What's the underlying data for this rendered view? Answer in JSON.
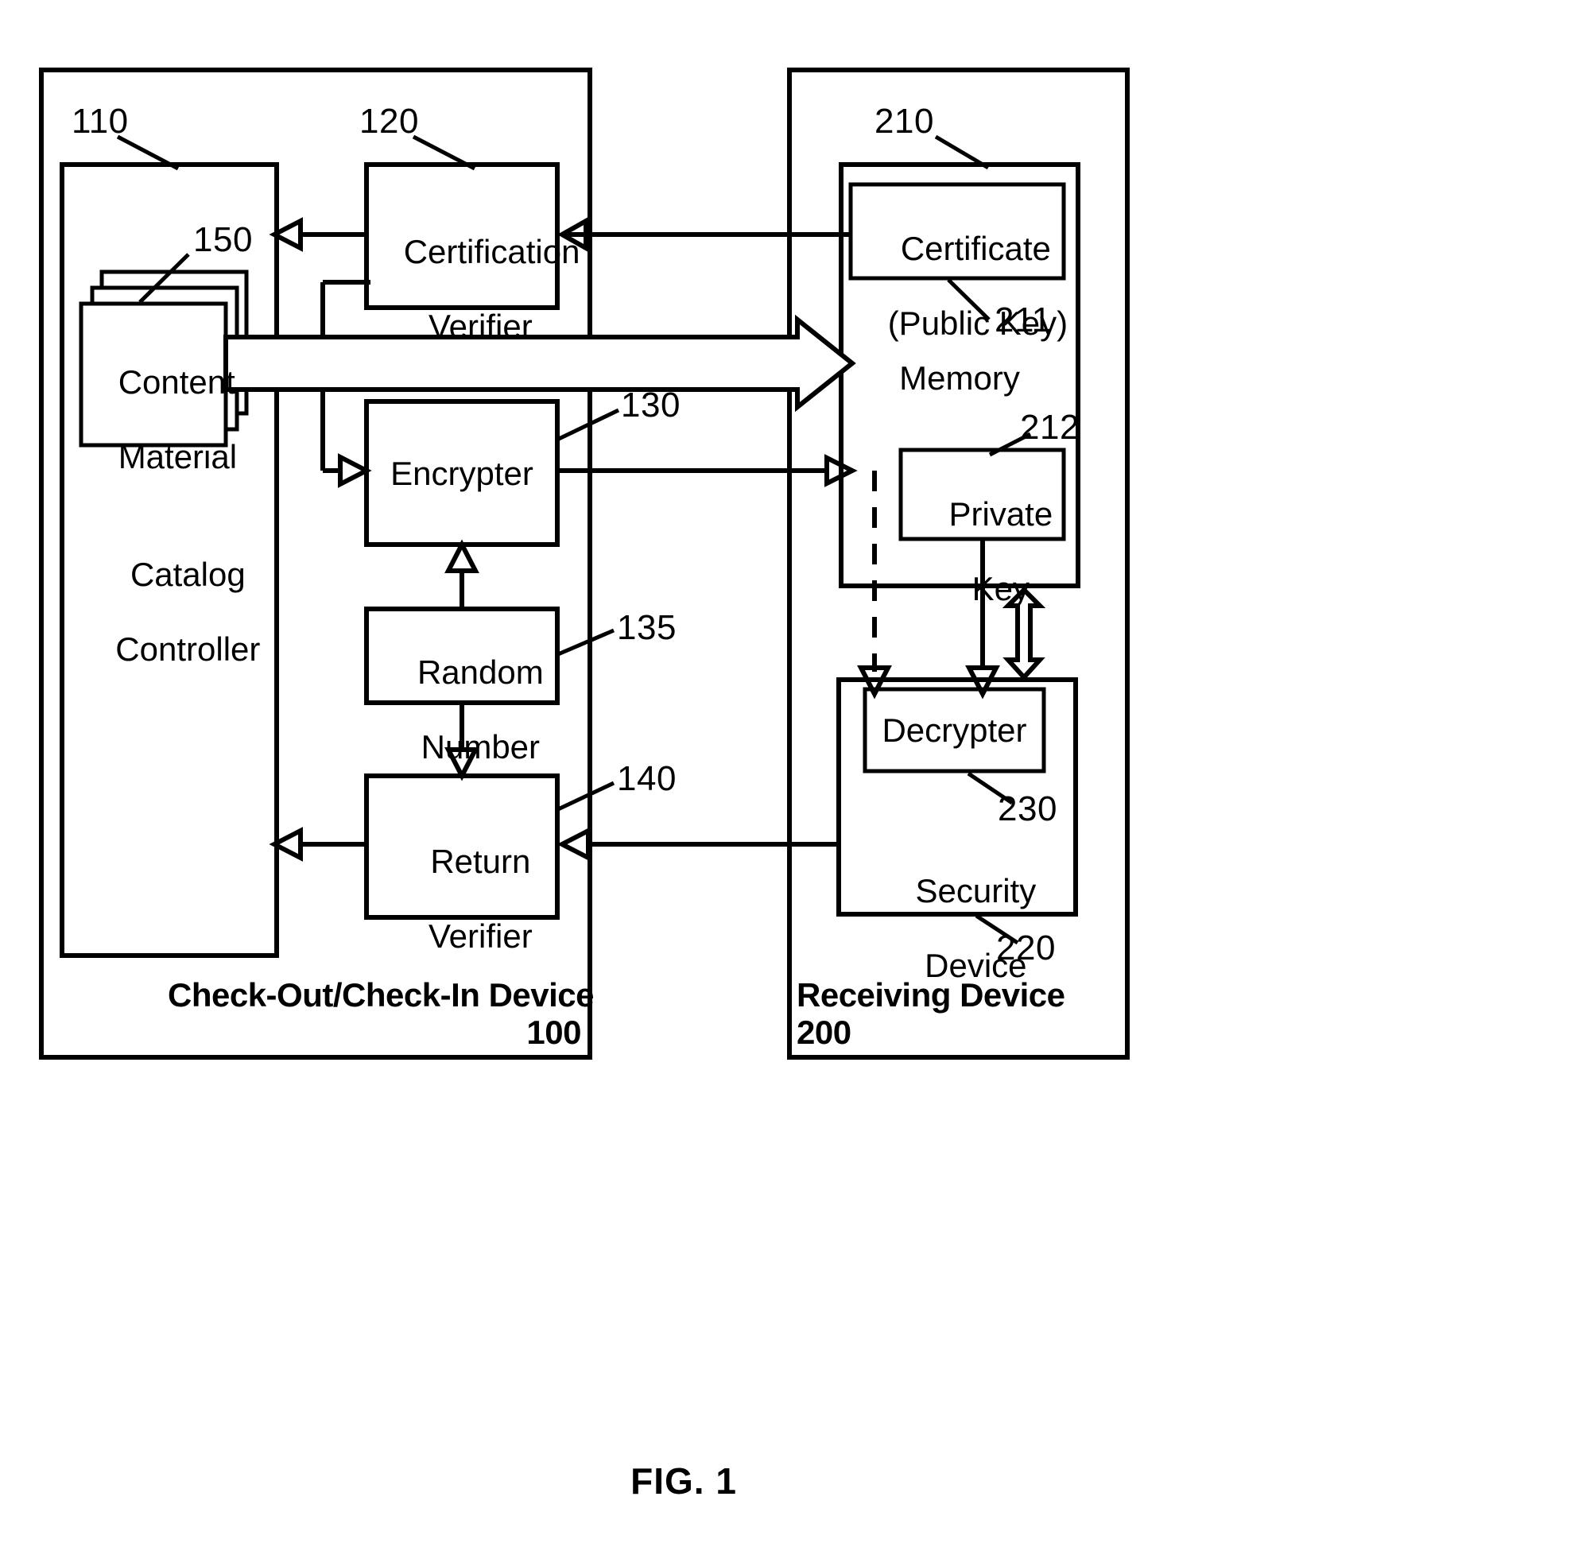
{
  "figure": {
    "caption": "FIG. 1",
    "title": "Check-Out/Check-In Device and Receiving Device block diagram"
  },
  "colors": {
    "stroke": "#000000",
    "background": "#ffffff"
  },
  "left_device": {
    "title": "Check-Out/Check-In Device",
    "ref": "100",
    "blocks": [
      {
        "id": "catalog_controller",
        "label": "Catalog\nController",
        "ref": "110"
      },
      {
        "id": "content_material",
        "label": "Content\nMaterial",
        "ref": "150"
      },
      {
        "id": "certification_verifier",
        "label": "Certification\nVerifier",
        "ref": "120"
      },
      {
        "id": "encrypter",
        "label": "Encrypter",
        "ref": "130"
      },
      {
        "id": "random_number",
        "label": "Random\nNumber",
        "ref": "135"
      },
      {
        "id": "return_verifier",
        "label": "Return\nVerifier",
        "ref": "140"
      }
    ]
  },
  "right_device": {
    "title": "Receiving Device",
    "ref": "200",
    "blocks": [
      {
        "id": "memory",
        "label": "Memory",
        "ref": "210"
      },
      {
        "id": "certificate",
        "label": "Certificate\n(Public Key)",
        "ref": "211"
      },
      {
        "id": "private_key",
        "label": "Private\nKey",
        "ref": "212"
      },
      {
        "id": "security_device",
        "label": "Security\nDevice",
        "ref": "220"
      },
      {
        "id": "decrypter",
        "label": "Decrypter",
        "ref": "230"
      }
    ]
  },
  "labels": {
    "catalog_controller": "Catalog\nController",
    "catalog_controller_line1": "Catalog",
    "catalog_controller_line2": "Controller",
    "content_material_line1": "Content",
    "content_material_line2": "Material",
    "certification_verifier_line1": "Certification",
    "certification_verifier_line2": "Verifier",
    "encrypter": "Encrypter",
    "random_number_line1": "Random",
    "random_number_line2": "Number",
    "return_verifier_line1": "Return",
    "return_verifier_line2": "Verifier",
    "memory": "Memory",
    "certificate_line1": "Certificate",
    "certificate_line2": "(Public Key)",
    "private_key_line1": "Private",
    "private_key_line2": "Key",
    "decrypter": "Decrypter",
    "security_device_line1": "Security",
    "security_device_line2": "Device",
    "left_device_title": "Check-Out/Check-In Device",
    "left_device_ref": "100",
    "right_device_title": "Receiving Device",
    "right_device_ref": "200",
    "figure_caption": "FIG. 1"
  },
  "refs": {
    "r110": "110",
    "r120": "120",
    "r130": "130",
    "r135": "135",
    "r140": "140",
    "r150": "150",
    "r210": "210",
    "r211": "211",
    "r212": "212",
    "r220": "220",
    "r230": "230"
  },
  "connections": [
    {
      "from": "certification_verifier",
      "to": "catalog_controller",
      "style": "solid",
      "arrow": "open-triangle"
    },
    {
      "from": "certificate",
      "to": "certification_verifier",
      "style": "solid",
      "arrow": "open-triangle"
    },
    {
      "from": "content_material",
      "to": "memory",
      "style": "solid",
      "arrow": "block-arrow"
    },
    {
      "from": "certification_verifier",
      "to": "encrypter",
      "style": "solid",
      "arrow": "open-triangle"
    },
    {
      "from": "encrypter",
      "to": "security_device",
      "style": "solid",
      "arrow": "open-triangle"
    },
    {
      "from": "random_number",
      "to": "encrypter",
      "style": "solid",
      "arrow": "open-triangle"
    },
    {
      "from": "random_number",
      "to": "return_verifier",
      "style": "solid",
      "arrow": "open-triangle"
    },
    {
      "from": "return_verifier",
      "to": "catalog_controller",
      "style": "solid",
      "arrow": "open-triangle"
    },
    {
      "from": "security_device",
      "to": "return_verifier",
      "style": "solid",
      "arrow": "open-triangle"
    },
    {
      "from": "encrypter_branch",
      "to": "decrypter",
      "style": "dashed",
      "arrow": "open-triangle"
    },
    {
      "from": "private_key",
      "to": "decrypter",
      "style": "solid",
      "arrow": "open-triangle"
    },
    {
      "from": "memory",
      "to": "decrypter",
      "style": "solid",
      "arrow": "double-block-arrow"
    }
  ]
}
